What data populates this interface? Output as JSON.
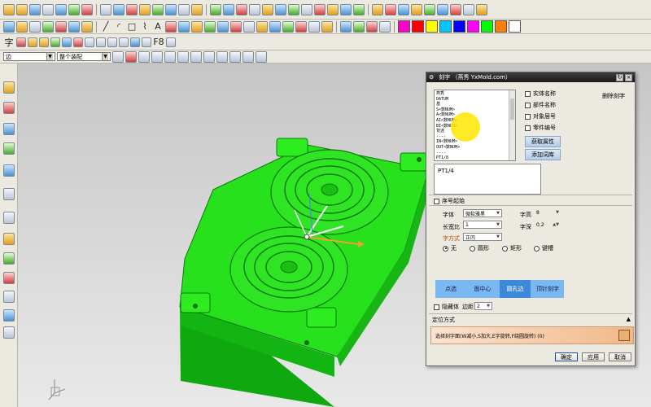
{
  "toolbar": {
    "selection_filter": "边",
    "assembly_scope": "整个装配",
    "text_tool_glyph": "A",
    "f8_label": "F8",
    "colors": [
      "#ff00c8",
      "#ff0000",
      "#ffff00",
      "#00c8ff",
      "#0000ff",
      "#ff00ff",
      "#00ff00",
      "#ff8000",
      "#ffffff"
    ]
  },
  "dialog": {
    "title": "刻字 （燕秀 YxMold.com）",
    "list_items": [
      "燕秀",
      "DATUM",
      "基",
      "S<数NUM>",
      "A<数NUM>",
      "AI<数NUM>",
      "BI<数NUM>",
      "背迷",
      "----",
      "IN<数NUM>",
      "OUT<数NUM>",
      "----",
      "PT1/8"
    ],
    "delete_button": "删除刻字",
    "checkboxes": [
      "实体名称",
      "部件名称",
      "对象层号",
      "零件编号"
    ],
    "get_attr_button": "获取属性",
    "add_lib_button": "添加词库",
    "text_value": "PT1/4",
    "seq_start_label": "序号起始",
    "font_label": "字体",
    "font_value": "微软雅黑",
    "height_label": "字高",
    "height_value": "8",
    "aspect_label": "长宽比",
    "aspect_value": "1",
    "depth_label": "字深",
    "depth_value": "0.2",
    "text_mode_label": "字方式",
    "text_mode_value": "正凹",
    "radios": [
      "无",
      "圆形",
      "矩形",
      "键槽"
    ],
    "modes": [
      "点选",
      "面中心",
      "圆孔边",
      "顶针刻字"
    ],
    "hide_body_label": "隐藏体",
    "edge_label": "边距",
    "edge_value": "2",
    "section_title": "定位方式",
    "prompt": "选择刻字面(W减小,S加大,E字旋转,F绕圆旋转) (0)",
    "ok_button": "确定",
    "apply_button": "应用",
    "cancel_button": "取消"
  }
}
